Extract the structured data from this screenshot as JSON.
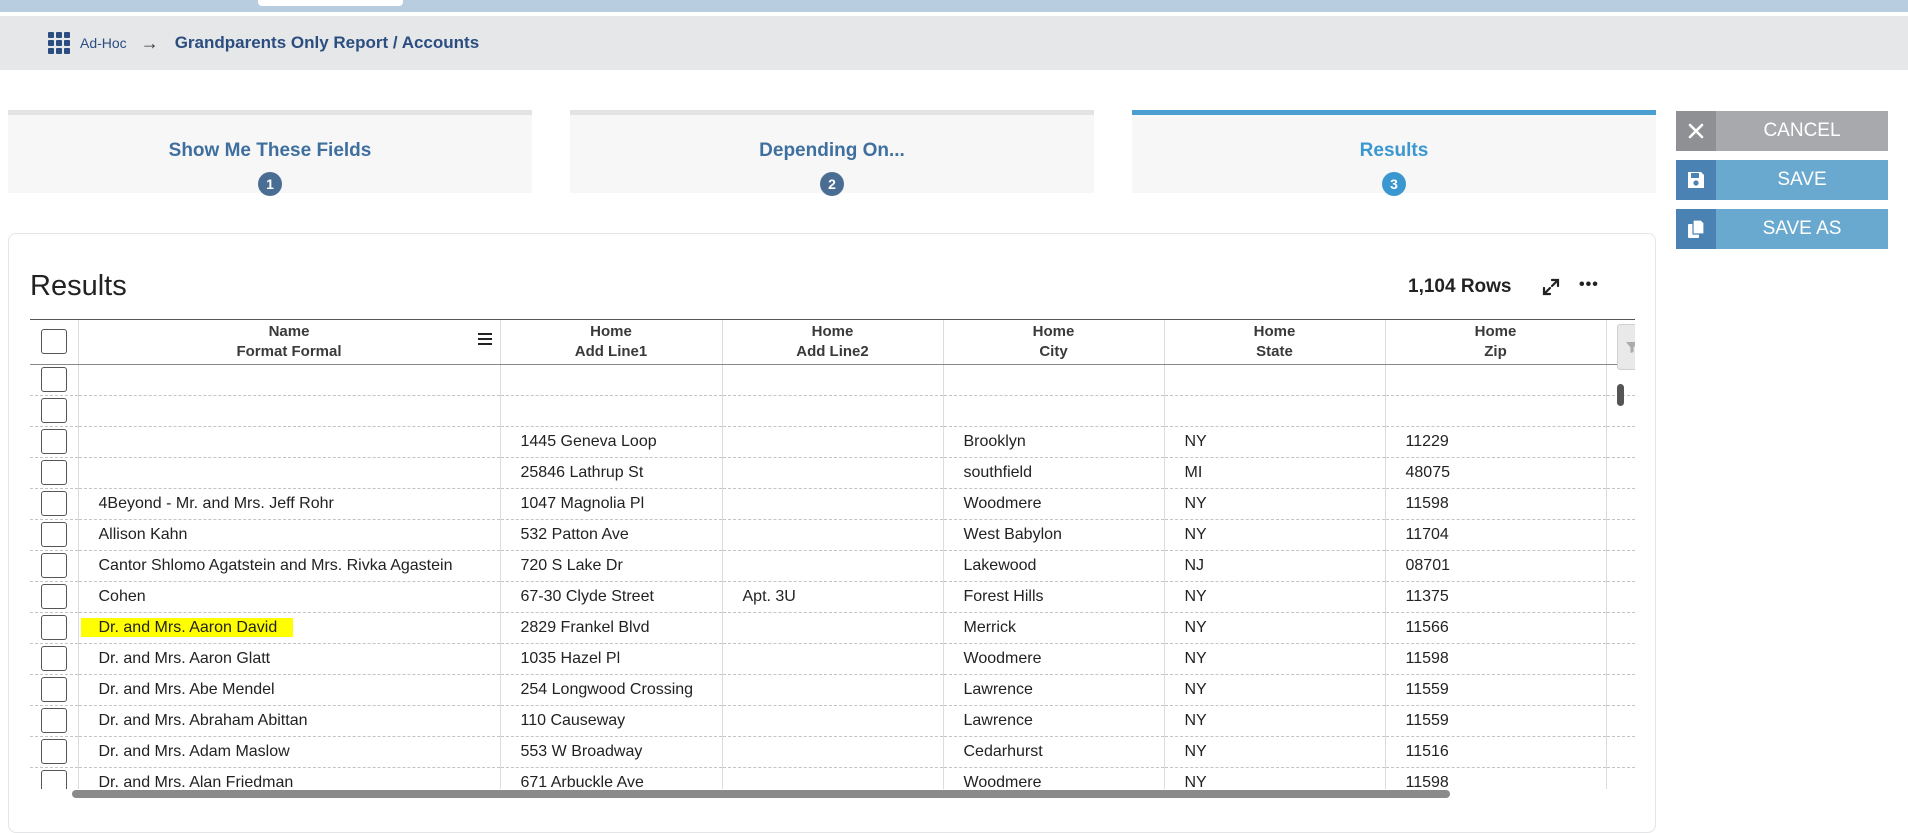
{
  "breadcrumb": {
    "root": "Ad-Hoc",
    "current": "Grandparents Only Report / Accounts"
  },
  "steps": [
    {
      "title": "Show Me These Fields",
      "num": "1"
    },
    {
      "title": "Depending On...",
      "num": "2"
    },
    {
      "title": "Results",
      "num": "3"
    }
  ],
  "actions": {
    "cancel": "CANCEL",
    "save": "SAVE",
    "save_as": "SAVE AS"
  },
  "results": {
    "title": "Results",
    "row_count": "1,104 Rows"
  },
  "table": {
    "headers": [
      {
        "line1": "Name",
        "line2": "Format Formal"
      },
      {
        "line1": "Home",
        "line2": "Add Line1"
      },
      {
        "line1": "Home",
        "line2": "Add Line2"
      },
      {
        "line1": "Home",
        "line2": "City"
      },
      {
        "line1": "Home",
        "line2": "State"
      },
      {
        "line1": "Home",
        "line2": "Zip"
      }
    ],
    "rows": [
      [
        "",
        "",
        "",
        "",
        "",
        ""
      ],
      [
        "",
        "",
        "",
        "",
        "",
        ""
      ],
      [
        "",
        "1445 Geneva Loop",
        "",
        "Brooklyn",
        "NY",
        "11229"
      ],
      [
        "",
        "25846 Lathrup St",
        "",
        "southfield",
        "MI",
        "48075"
      ],
      [
        "4Beyond - Mr. and Mrs. Jeff Rohr",
        "1047 Magnolia Pl",
        "",
        "Woodmere",
        "NY",
        "11598"
      ],
      [
        "Allison Kahn",
        "532 Patton Ave",
        "",
        "West Babylon",
        "NY",
        "11704"
      ],
      [
        "Cantor Shlomo Agatstein and Mrs. Rivka Agastein",
        "720 S Lake Dr",
        "",
        "Lakewood",
        "NJ",
        "08701"
      ],
      [
        "Cohen",
        "67-30 Clyde Street",
        "Apt. 3U",
        "Forest Hills",
        "NY",
        "11375"
      ],
      [
        "Dr. and Mrs. Aaron David",
        "2829 Frankel Blvd",
        "",
        "Merrick",
        "NY",
        "11566"
      ],
      [
        "Dr. and Mrs. Aaron Glatt",
        "1035 Hazel Pl",
        "",
        "Woodmere",
        "NY",
        "11598"
      ],
      [
        "Dr. and Mrs. Abe Mendel",
        "254 Longwood Crossing",
        "",
        "Lawrence",
        "NY",
        "11559"
      ],
      [
        "Dr. and Mrs. Abraham Abittan",
        "110 Causeway",
        "",
        "Lawrence",
        "NY",
        "11559"
      ],
      [
        "Dr. and Mrs. Adam Maslow",
        "553 W Broadway",
        "",
        "Cedarhurst",
        "NY",
        "11516"
      ],
      [
        "Dr. and Mrs. Alan Friedman",
        "671 Arbuckle Ave",
        "",
        "Woodmere",
        "NY",
        "11598"
      ]
    ],
    "highlighted_row": 8,
    "highlight_color": "#ffff00"
  },
  "colors": {
    "accent": "#3b97cf",
    "step_num": "#4a6d93",
    "breadcrumb_text": "#2b4d80"
  }
}
